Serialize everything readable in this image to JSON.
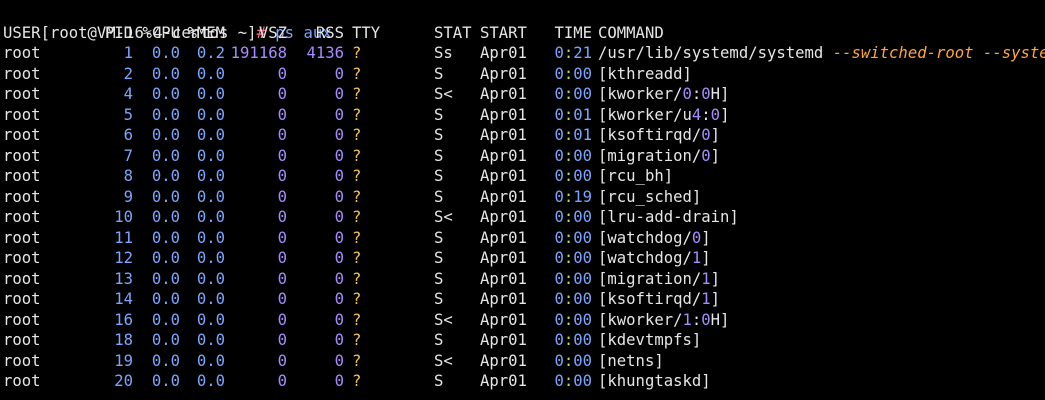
{
  "prompt": {
    "text": "[root@VM-16-4-centos ~]",
    "symbol": "#",
    "command": "ps aux"
  },
  "headers": {
    "user": "USER",
    "pid": "PID",
    "cpu": "%CPU",
    "mem": "%MEM",
    "vsz": "VSZ",
    "rss": "RSS",
    "tty": "TTY",
    "stat": "STAT",
    "start": "START",
    "time": "TIME",
    "command": "COMMAND"
  },
  "colors": {
    "background": "#000000",
    "text": "#e6e6e6",
    "number": "#7aa6ff",
    "size": "#a98bff",
    "accent_green": "#b7e34b",
    "args": "#ffa53b"
  },
  "processes": [
    {
      "user": "root",
      "pid": "1",
      "cpu": "0.0",
      "mem": "0.2",
      "vsz": "191168",
      "rss": "4136",
      "tty": "?",
      "stat": "Ss",
      "start": "Apr01",
      "time_h": "0",
      "time_sep": ":",
      "time_m": "21",
      "cmd_pre": "/usr/lib/systemd/systemd ",
      "cmd_args": "--switched-root --system"
    },
    {
      "user": "root",
      "pid": "2",
      "cpu": "0.0",
      "mem": "0.0",
      "vsz": "0",
      "rss": "0",
      "tty": "?",
      "stat": "S",
      "start": "Apr01",
      "time_h": "0",
      "time_sep": ":",
      "time_m": "00",
      "cmd_pre": "[kthreadd]"
    },
    {
      "user": "root",
      "pid": "4",
      "cpu": "0.0",
      "mem": "0.0",
      "vsz": "0",
      "rss": "0",
      "tty": "?",
      "stat": "S<",
      "start": "Apr01",
      "time_h": "0",
      "time_sep": ":",
      "time_m": "00",
      "cmd_pre": "[kworker/0:0H]"
    },
    {
      "user": "root",
      "pid": "5",
      "cpu": "0.0",
      "mem": "0.0",
      "vsz": "0",
      "rss": "0",
      "tty": "?",
      "stat": "S",
      "start": "Apr01",
      "time_h": "0",
      "time_sep": ":",
      "time_m": "01",
      "cmd_pre": "[kworker/u4:0]"
    },
    {
      "user": "root",
      "pid": "6",
      "cpu": "0.0",
      "mem": "0.0",
      "vsz": "0",
      "rss": "0",
      "tty": "?",
      "stat": "S",
      "start": "Apr01",
      "time_h": "0",
      "time_sep": ":",
      "time_m": "01",
      "cmd_pre": "[ksoftirqd/0]"
    },
    {
      "user": "root",
      "pid": "7",
      "cpu": "0.0",
      "mem": "0.0",
      "vsz": "0",
      "rss": "0",
      "tty": "?",
      "stat": "S",
      "start": "Apr01",
      "time_h": "0",
      "time_sep": ":",
      "time_m": "00",
      "cmd_pre": "[migration/0]"
    },
    {
      "user": "root",
      "pid": "8",
      "cpu": "0.0",
      "mem": "0.0",
      "vsz": "0",
      "rss": "0",
      "tty": "?",
      "stat": "S",
      "start": "Apr01",
      "time_h": "0",
      "time_sep": ":",
      "time_m": "00",
      "cmd_pre": "[rcu_bh]"
    },
    {
      "user": "root",
      "pid": "9",
      "cpu": "0.0",
      "mem": "0.0",
      "vsz": "0",
      "rss": "0",
      "tty": "?",
      "stat": "S",
      "start": "Apr01",
      "time_h": "0",
      "time_sep": ":",
      "time_m": "19",
      "cmd_pre": "[rcu_sched]"
    },
    {
      "user": "root",
      "pid": "10",
      "cpu": "0.0",
      "mem": "0.0",
      "vsz": "0",
      "rss": "0",
      "tty": "?",
      "stat": "S<",
      "start": "Apr01",
      "time_h": "0",
      "time_sep": ":",
      "time_m": "00",
      "cmd_pre": "[lru-add-drain]"
    },
    {
      "user": "root",
      "pid": "11",
      "cpu": "0.0",
      "mem": "0.0",
      "vsz": "0",
      "rss": "0",
      "tty": "?",
      "stat": "S",
      "start": "Apr01",
      "time_h": "0",
      "time_sep": ":",
      "time_m": "00",
      "cmd_pre": "[watchdog/0]"
    },
    {
      "user": "root",
      "pid": "12",
      "cpu": "0.0",
      "mem": "0.0",
      "vsz": "0",
      "rss": "0",
      "tty": "?",
      "stat": "S",
      "start": "Apr01",
      "time_h": "0",
      "time_sep": ":",
      "time_m": "00",
      "cmd_pre": "[watchdog/1]"
    },
    {
      "user": "root",
      "pid": "13",
      "cpu": "0.0",
      "mem": "0.0",
      "vsz": "0",
      "rss": "0",
      "tty": "?",
      "stat": "S",
      "start": "Apr01",
      "time_h": "0",
      "time_sep": ":",
      "time_m": "00",
      "cmd_pre": "[migration/1]"
    },
    {
      "user": "root",
      "pid": "14",
      "cpu": "0.0",
      "mem": "0.0",
      "vsz": "0",
      "rss": "0",
      "tty": "?",
      "stat": "S",
      "start": "Apr01",
      "time_h": "0",
      "time_sep": ":",
      "time_m": "00",
      "cmd_pre": "[ksoftirqd/1]"
    },
    {
      "user": "root",
      "pid": "16",
      "cpu": "0.0",
      "mem": "0.0",
      "vsz": "0",
      "rss": "0",
      "tty": "?",
      "stat": "S<",
      "start": "Apr01",
      "time_h": "0",
      "time_sep": ":",
      "time_m": "00",
      "cmd_pre": "[kworker/1:0H]"
    },
    {
      "user": "root",
      "pid": "18",
      "cpu": "0.0",
      "mem": "0.0",
      "vsz": "0",
      "rss": "0",
      "tty": "?",
      "stat": "S",
      "start": "Apr01",
      "time_h": "0",
      "time_sep": ":",
      "time_m": "00",
      "cmd_pre": "[kdevtmpfs]"
    },
    {
      "user": "root",
      "pid": "19",
      "cpu": "0.0",
      "mem": "0.0",
      "vsz": "0",
      "rss": "0",
      "tty": "?",
      "stat": "S<",
      "start": "Apr01",
      "time_h": "0",
      "time_sep": ":",
      "time_m": "00",
      "cmd_pre": "[netns]"
    },
    {
      "user": "root",
      "pid": "20",
      "cpu": "0.0",
      "mem": "0.0",
      "vsz": "0",
      "rss": "0",
      "tty": "?",
      "stat": "S",
      "start": "Apr01",
      "time_h": "0",
      "time_sep": ":",
      "time_m": "00",
      "cmd_pre": "[khungtaskd]"
    }
  ]
}
